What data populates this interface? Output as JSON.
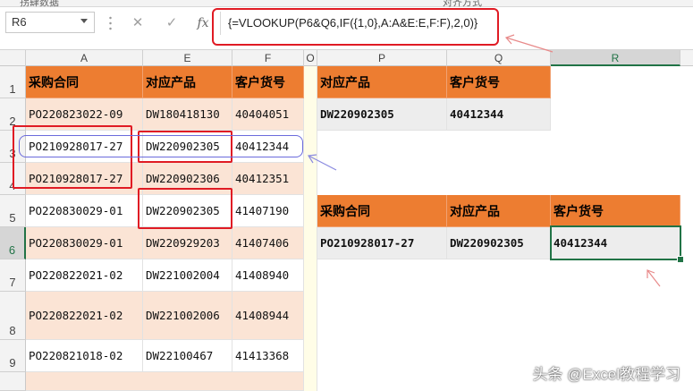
{
  "ribbon": {
    "fragment_left": "拐肆数据",
    "fragment_mid": "对齐方式"
  },
  "formula_bar": {
    "name_box": "R6",
    "cancel_icon": "cancel-icon",
    "enter_icon": "enter-icon",
    "fx_label": "fx",
    "formula": "{=VLOOKUP(P6&Q6,IF({1,0},A:A&E:E,F:F),2,0)}"
  },
  "columns": [
    "A",
    "E",
    "F",
    "O",
    "P",
    "Q",
    "R"
  ],
  "selected_column": "R",
  "rows": [
    "1",
    "2",
    "3",
    "4",
    "5",
    "6",
    "7",
    "8",
    "9"
  ],
  "selected_row": "6",
  "left_table": {
    "headers": [
      "采购合同",
      "对应产品",
      "客户货号"
    ],
    "rows": [
      [
        "PO220823022-09",
        "DW180418130",
        "40404051"
      ],
      [
        "PO210928017-27",
        "DW220902305",
        "40412344"
      ],
      [
        "PO210928017-27",
        "DW220902306",
        "40412351"
      ],
      [
        "PO220830029-01",
        "DW220902305",
        "41407190"
      ],
      [
        "PO220830029-01",
        "DW220929203",
        "41407406"
      ],
      [
        "PO220822021-02",
        "DW221002004",
        "41408940"
      ],
      [
        "PO220822021-02",
        "DW221002006",
        "41408944"
      ],
      [
        "PO220821018-02",
        "DW22100467",
        "41413368"
      ]
    ]
  },
  "lookup_table": {
    "headers": [
      "对应产品",
      "客户货号"
    ],
    "values": [
      "DW220902305",
      "40412344"
    ]
  },
  "result_table": {
    "headers": [
      "采购合同",
      "对应产品",
      "客户货号"
    ],
    "values": [
      "PO210928017-27",
      "DW220902305",
      "40412344"
    ]
  },
  "watermark": "头条 @Excel教程学习",
  "colors": {
    "header_orange": "#ed7d31",
    "light_orange": "#fbe4d5",
    "excel_green": "#217346",
    "annotation_red": "#e01b24",
    "annotation_blue": "#6b6bdc"
  }
}
